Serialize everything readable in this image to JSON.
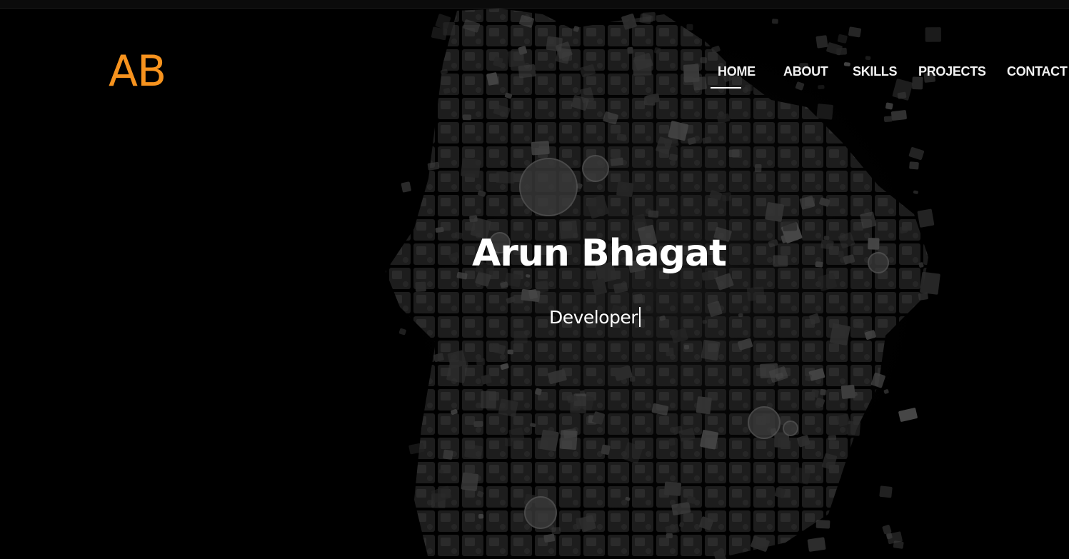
{
  "header": {
    "logo": "AB",
    "nav": [
      {
        "label": "HOME",
        "active": true
      },
      {
        "label": "ABOUT",
        "active": false
      },
      {
        "label": "SKILLS",
        "active": false
      },
      {
        "label": "PROJECTS",
        "active": false
      },
      {
        "label": "CONTACT",
        "active": false
      }
    ]
  },
  "hero": {
    "title": "Arun Bhagat",
    "subtitle": "Developer",
    "background": "mosaic-of-tech-devices-silhouette"
  },
  "colors": {
    "background": "#000000",
    "accent": "#f7931e",
    "text": "#ffffff"
  }
}
